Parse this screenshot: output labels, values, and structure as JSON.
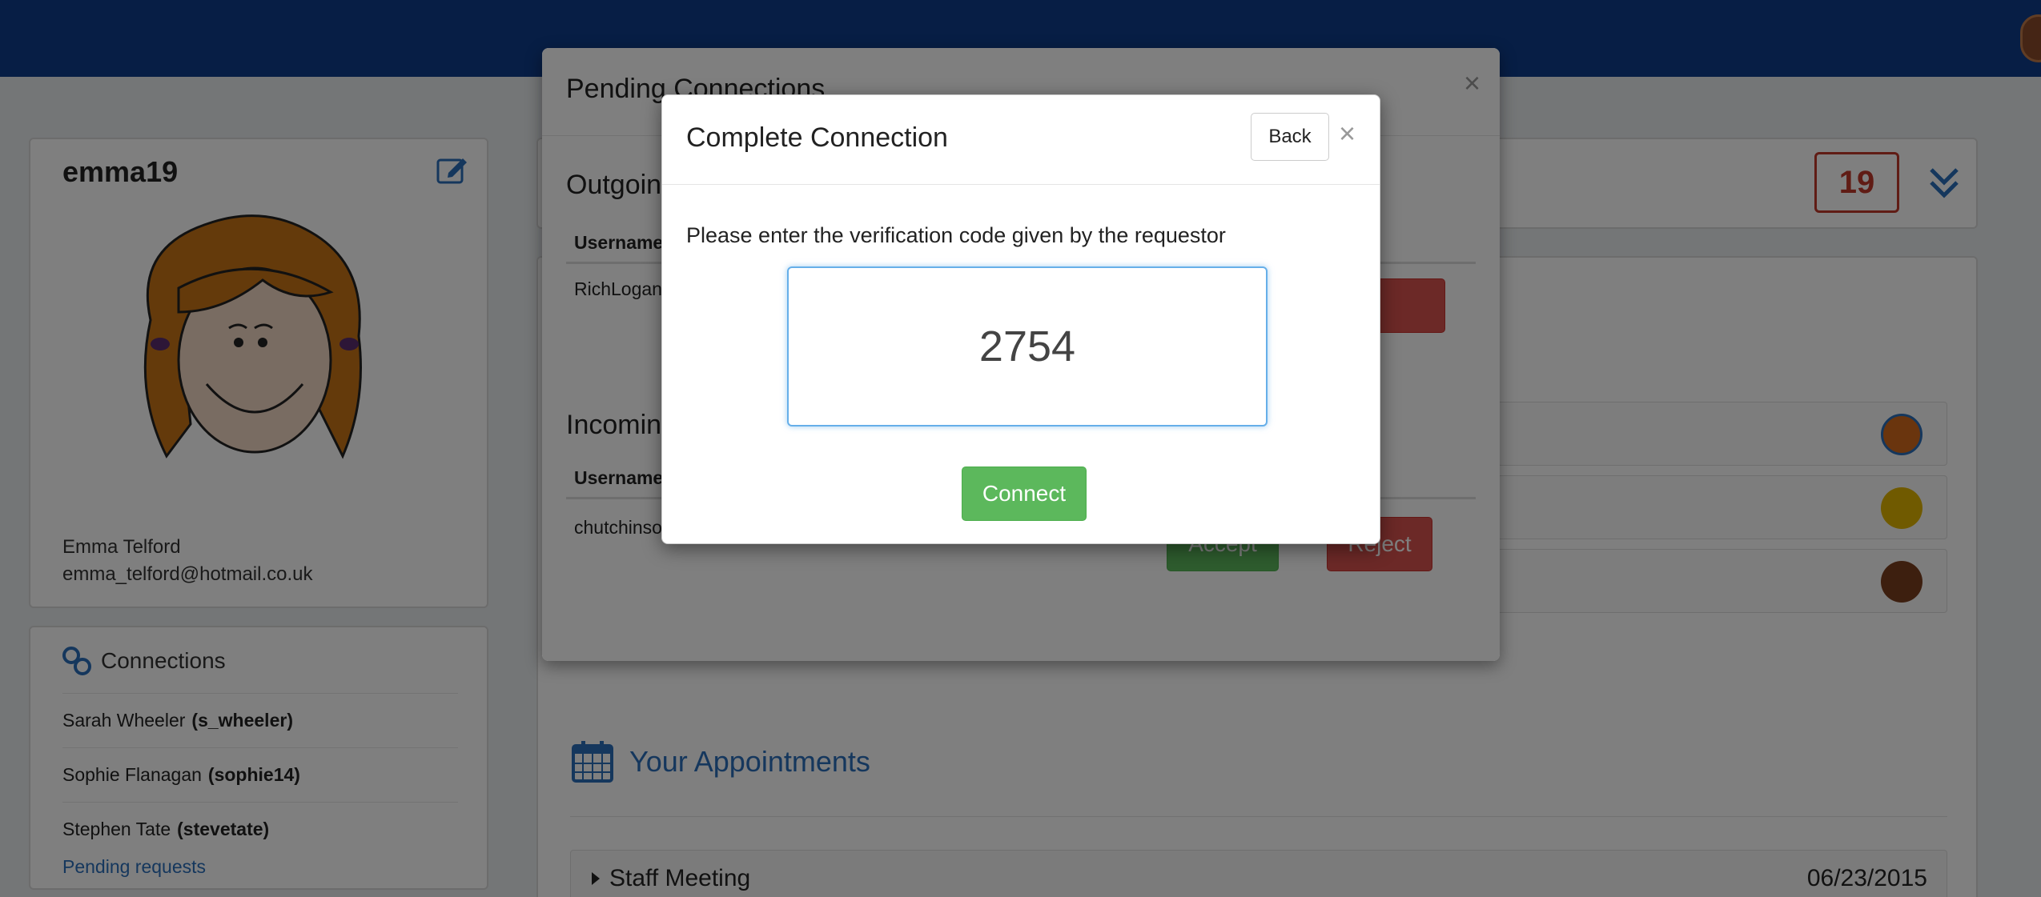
{
  "profile": {
    "username": "emma19",
    "full_name": "Emma Telford",
    "email": "emma_telford@hotmail.co.uk"
  },
  "connections": {
    "title": "Connections",
    "items": [
      {
        "name": "Sarah Wheeler",
        "username": "(s_wheeler)"
      },
      {
        "name": "Sophie Flanagan",
        "username": "(sophie14)"
      },
      {
        "name": "Stephen Tate",
        "username": "(stevetate)"
      }
    ],
    "pending_link": "Pending requests"
  },
  "main": {
    "count_badge": "19",
    "appointments_title": "Your Appointments",
    "appointment": {
      "name": "Staff Meeting",
      "date": "06/23/2015"
    }
  },
  "pending_modal": {
    "title": "Pending Connections",
    "close": "×",
    "outgoing_title": "Outgoing",
    "incoming_title": "Incoming",
    "username_header": "Username",
    "outgoing_user": "RichLogan",
    "incoming_user": "chutchinson",
    "accept_label": "Accept",
    "reject_label": "Reject"
  },
  "complete_modal": {
    "title": "Complete Connection",
    "back_label": "Back",
    "close": "×",
    "prompt": "Please enter the verification code given by the requestor",
    "code_value": "2754",
    "connect_label": "Connect"
  },
  "colors": {
    "nav": "#0e3c8a",
    "accent": "#2a6ebb",
    "danger": "#d9534f",
    "success": "#5cb85c"
  }
}
